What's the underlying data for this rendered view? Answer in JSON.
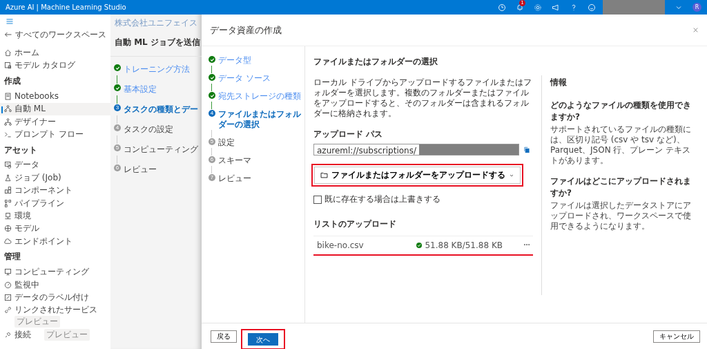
{
  "top_bar": {
    "title": "Azure AI | Machine Learning Studio",
    "notification_count": "1",
    "avatar": "R"
  },
  "sidebar": {
    "back": "すべてのワークスペース",
    "sections": [
      {
        "items": [
          {
            "label": "ホーム",
            "selected": false
          },
          {
            "label": "モデル カタログ",
            "selected": false
          }
        ]
      },
      {
        "heading": "作成",
        "items": [
          {
            "label": "Notebooks",
            "selected": false
          },
          {
            "label": "自動 ML",
            "selected": true
          },
          {
            "label": "デザイナー",
            "selected": false
          },
          {
            "label": "プロンプト フロー",
            "selected": false
          }
        ]
      },
      {
        "heading": "アセット",
        "items": [
          {
            "label": "データ",
            "selected": false
          },
          {
            "label": "ジョブ (Job)",
            "selected": false
          },
          {
            "label": "コンポーネント",
            "selected": false
          },
          {
            "label": "パイプライン",
            "selected": false
          },
          {
            "label": "環境",
            "selected": false
          },
          {
            "label": "モデル",
            "selected": false
          },
          {
            "label": "エンドポイント",
            "selected": false
          }
        ]
      },
      {
        "heading": "管理",
        "items": [
          {
            "label": "コンピューティング",
            "selected": false
          },
          {
            "label": "監視中",
            "selected": false
          },
          {
            "label": "データのラベル付け",
            "selected": false
          },
          {
            "label": "リンクされたサービス",
            "selected": false,
            "badge": "プレビュー"
          },
          {
            "label": "接続",
            "selected": false,
            "badge": "プレビュー"
          }
        ]
      }
    ]
  },
  "background_page": {
    "breadcrumb": "株式会社ユニフェイス",
    "title": "自動 ML ジョブを送信",
    "steps": [
      {
        "label": "トレーニング方法",
        "done": true,
        "current": false
      },
      {
        "label": "基本設定",
        "done": true,
        "current": false
      },
      {
        "label": "タスクの種類とデー",
        "done": false,
        "current": true,
        "number": "3"
      },
      {
        "label": "タスクの設定",
        "done": false,
        "current": false,
        "number": "4"
      },
      {
        "label": "コンピューティング",
        "done": false,
        "current": false,
        "number": "5"
      },
      {
        "label": "レビュー",
        "done": false,
        "current": false,
        "number": "6"
      }
    ]
  },
  "dialog": {
    "title": "データ資産の作成",
    "steps": [
      {
        "label": "データ型",
        "done": true,
        "current": false
      },
      {
        "label": "データ ソース",
        "done": true,
        "current": false
      },
      {
        "label": "宛先ストレージの種類",
        "done": true,
        "current": false
      },
      {
        "label": "ファイルまたはフォルダーの選択",
        "done": false,
        "current": true,
        "number": "4"
      },
      {
        "label": "設定",
        "done": false,
        "current": false,
        "number": "5"
      },
      {
        "label": "スキーマ",
        "done": false,
        "current": false,
        "number": "6"
      },
      {
        "label": "レビュー",
        "done": false,
        "current": false,
        "number": "7"
      }
    ],
    "heading": "ファイルまたはフォルダーの選択",
    "description": "ローカル ドライブからアップロードするファイルまたはフォルダーを選択します。複数のフォルダーまたはファイルをアップロードすると、そのフォルダーは含まれるフォルダーに格納されます。",
    "upload_path": {
      "label": "アップロード パス",
      "value": "azureml://subscriptions/"
    },
    "upload_button": "ファイルまたはフォルダーをアップロードする",
    "overwrite": {
      "label": "既に存在する場合は上書きする",
      "checked": false
    },
    "upload_list": {
      "heading": "リストのアップロード",
      "rows": [
        {
          "name": "bike-no.csv",
          "complete": true,
          "progress": "51.88 KB/51.88 KB"
        }
      ]
    },
    "info": {
      "heading": "情報",
      "faqs": [
        {
          "question": "どのようなファイルの種類を使用できますか?",
          "answer": "サポートされているファイルの種類には、区切り記号 (csv や tsv など)、Parquet、JSON 行、プレーン テキストがあります。"
        },
        {
          "question": "ファイルはどこにアップロードされますか?",
          "answer": "ファイルは選択したデータストアにアップロードされ、ワークスペースで使用できるようになります。"
        }
      ]
    },
    "footer": {
      "back": "戻る",
      "next": "次へ",
      "cancel": "キャンセル"
    }
  }
}
